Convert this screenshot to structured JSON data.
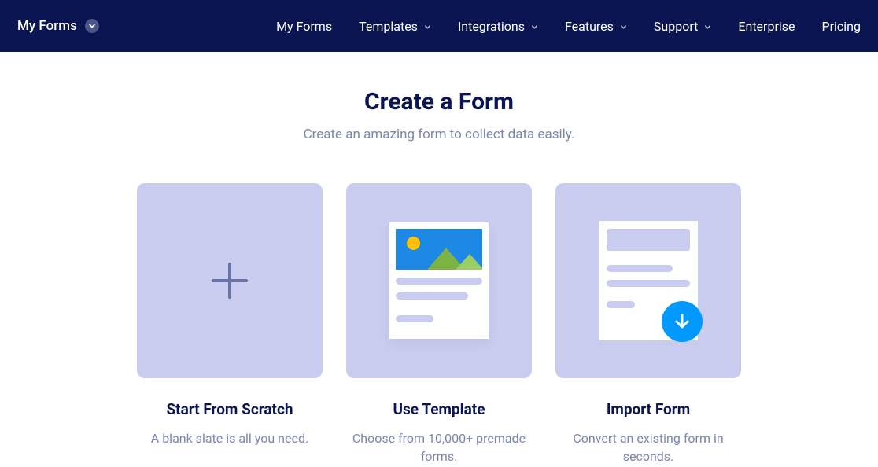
{
  "nav": {
    "brand": "My Forms",
    "items": [
      {
        "label": "My Forms",
        "dropdown": false
      },
      {
        "label": "Templates",
        "dropdown": true
      },
      {
        "label": "Integrations",
        "dropdown": true
      },
      {
        "label": "Features",
        "dropdown": true
      },
      {
        "label": "Support",
        "dropdown": true
      },
      {
        "label": "Enterprise",
        "dropdown": false
      },
      {
        "label": "Pricing",
        "dropdown": false
      }
    ]
  },
  "header": {
    "title": "Create a Form",
    "subtitle": "Create an amazing form to collect data easily."
  },
  "cards": {
    "scratch": {
      "title": "Start From Scratch",
      "desc": "A blank slate is all you need."
    },
    "template": {
      "title": "Use Template",
      "desc": "Choose from 10,000+ premade forms."
    },
    "import": {
      "title": "Import Form",
      "desc": "Convert an existing form in seconds."
    }
  }
}
